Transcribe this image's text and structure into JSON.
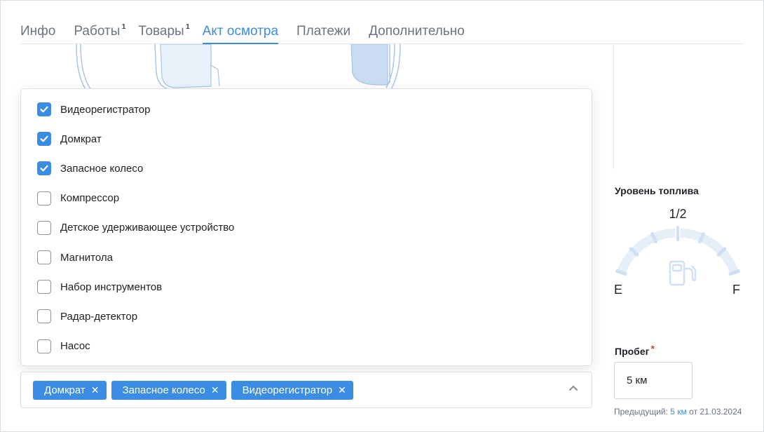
{
  "tabs": [
    {
      "label": "Инфо",
      "badge": ""
    },
    {
      "label": "Работы",
      "badge": "1"
    },
    {
      "label": "Товары",
      "badge": "1"
    },
    {
      "label": "Акт осмотра",
      "badge": ""
    },
    {
      "label": "Платежи",
      "badge": ""
    },
    {
      "label": "Дополнительно",
      "badge": ""
    }
  ],
  "active_tab": "Акт осмотра",
  "options": [
    {
      "label": "Видеорегистратор",
      "checked": true
    },
    {
      "label": "Домкрат",
      "checked": true
    },
    {
      "label": "Запасное колесо",
      "checked": true
    },
    {
      "label": "Компрессор",
      "checked": false
    },
    {
      "label": "Детское удерживающее устройство",
      "checked": false
    },
    {
      "label": "Магнитола",
      "checked": false
    },
    {
      "label": "Набор инструментов",
      "checked": false
    },
    {
      "label": "Радар-детектор",
      "checked": false
    },
    {
      "label": "Насос",
      "checked": false
    }
  ],
  "selected_chips": [
    "Домкрат",
    "Запасное колесо",
    "Видеорегистратор"
  ],
  "fuel": {
    "title": "Уровень топлива",
    "value_label": "1/2",
    "level": 0.5,
    "empty_label": "E",
    "full_label": "F"
  },
  "mileage": {
    "label": "Пробег",
    "required_mark": "*",
    "value": "5 км",
    "prev_prefix": "Предыдущий:",
    "prev_value": "5 км",
    "prev_suffix": "от 21.03.2024"
  },
  "icons": {
    "check": "check-icon",
    "remove": "close-icon",
    "collapse": "chevron-up-icon",
    "fuel": "fuel-pump-icon"
  },
  "colors": {
    "accent": "#3a8de3",
    "tab_text": "#6b7480",
    "required": "#e0403a",
    "gauge_light": "#e6eef8",
    "gauge_tick": "#cfe0f5"
  }
}
